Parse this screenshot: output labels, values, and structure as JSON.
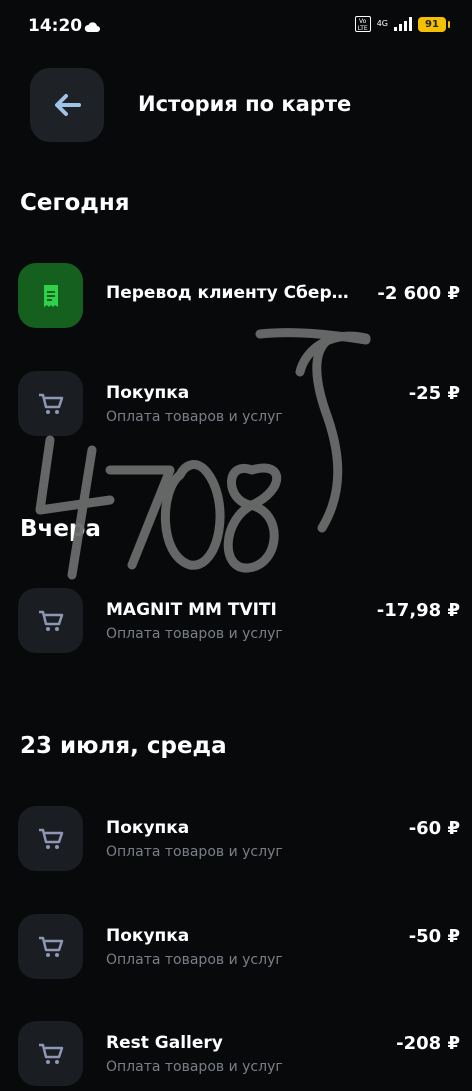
{
  "status_bar": {
    "time": "14:20",
    "network": "4G",
    "volte": "Vo LTE",
    "battery": "91"
  },
  "header": {
    "title": "История по карте"
  },
  "sections": [
    {
      "label": "Сегодня",
      "items": [
        {
          "title": "Перевод клиенту Сбербанка",
          "subtitle": "",
          "amount": "-2 600 ₽",
          "icon": "receipt-icon"
        },
        {
          "title": "Покупка",
          "subtitle": "Оплата товаров и услуг",
          "amount": "-25 ₽",
          "icon": "cart-icon"
        }
      ]
    },
    {
      "label": "Вчера",
      "items": [
        {
          "title": "MAGNIT MM TVITI",
          "subtitle": "Оплата товаров и услуг",
          "amount": "-17,98 ₽",
          "icon": "cart-icon"
        }
      ]
    },
    {
      "label": "23 июля, среда",
      "items": [
        {
          "title": "Покупка",
          "subtitle": "Оплата товаров и услуг",
          "amount": "-60 ₽",
          "icon": "cart-icon"
        },
        {
          "title": "Покупка",
          "subtitle": "Оплата товаров и услуг",
          "amount": "-50 ₽",
          "icon": "cart-icon"
        },
        {
          "title": "Rest Gallery",
          "subtitle": "Оплата товаров и услуг",
          "amount": "-208 ₽",
          "icon": "cart-icon"
        }
      ]
    }
  ],
  "handwriting": "4708",
  "colors": {
    "background": "#08090b",
    "accent_green": "#16601f",
    "icon_tint": "#8e97b4"
  }
}
